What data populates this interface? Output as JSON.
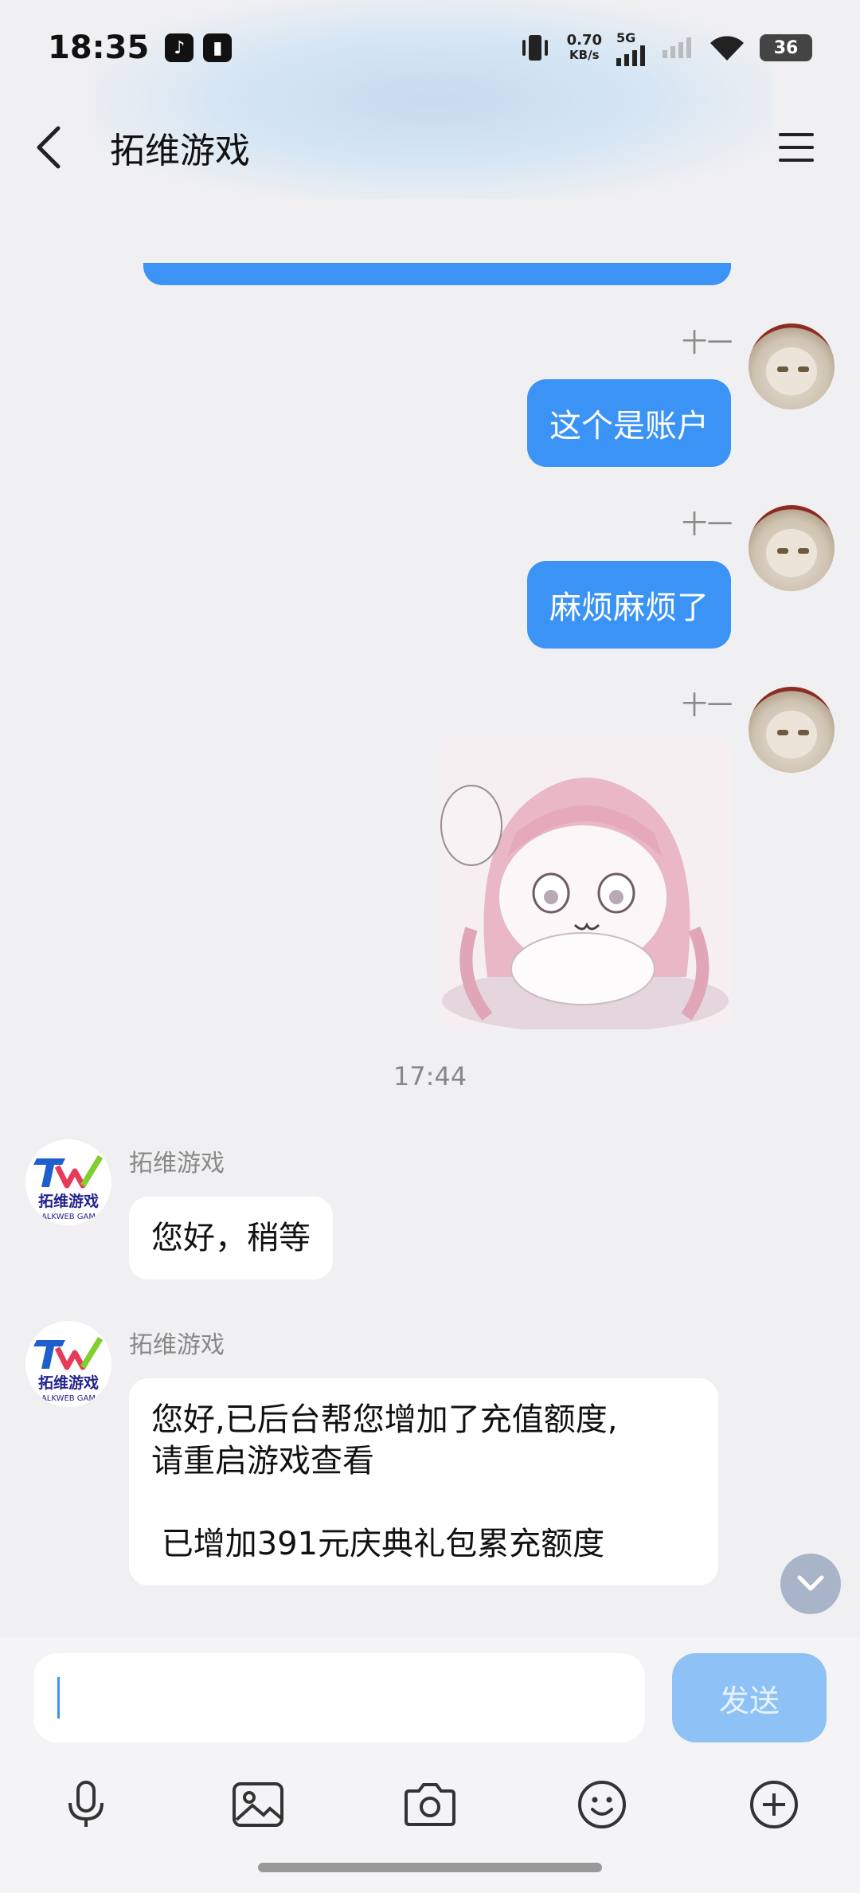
{
  "status_bar": {
    "time": "18:35",
    "net_speed_value": "0.70",
    "net_speed_unit": "KB/s",
    "net_type": "5G",
    "battery": "36"
  },
  "header": {
    "title": "拓维游戏"
  },
  "messages": {
    "out1": {
      "nick": "十一",
      "text": "这个是账户"
    },
    "out2": {
      "nick": "十一",
      "text": "麻烦麻烦了"
    },
    "out3": {
      "nick": "十一"
    },
    "time_divider": "17:44",
    "in1": {
      "nick": "拓维游戏",
      "text": "您好，稍等"
    },
    "in2": {
      "nick": "拓维游戏",
      "text": "您好,已后台帮您增加了充值额度,\n请重启游戏查看\n\n 已增加391元庆典礼包累充额度"
    }
  },
  "input": {
    "placeholder": "",
    "send_label": "发送"
  },
  "colors": {
    "accent": "#3b93f5",
    "send_disabled": "#8ec2f7",
    "background": "#f0f0f2"
  },
  "toolbar_icons": [
    "microphone-icon",
    "image-icon",
    "camera-icon",
    "emoji-icon",
    "plus-icon"
  ]
}
